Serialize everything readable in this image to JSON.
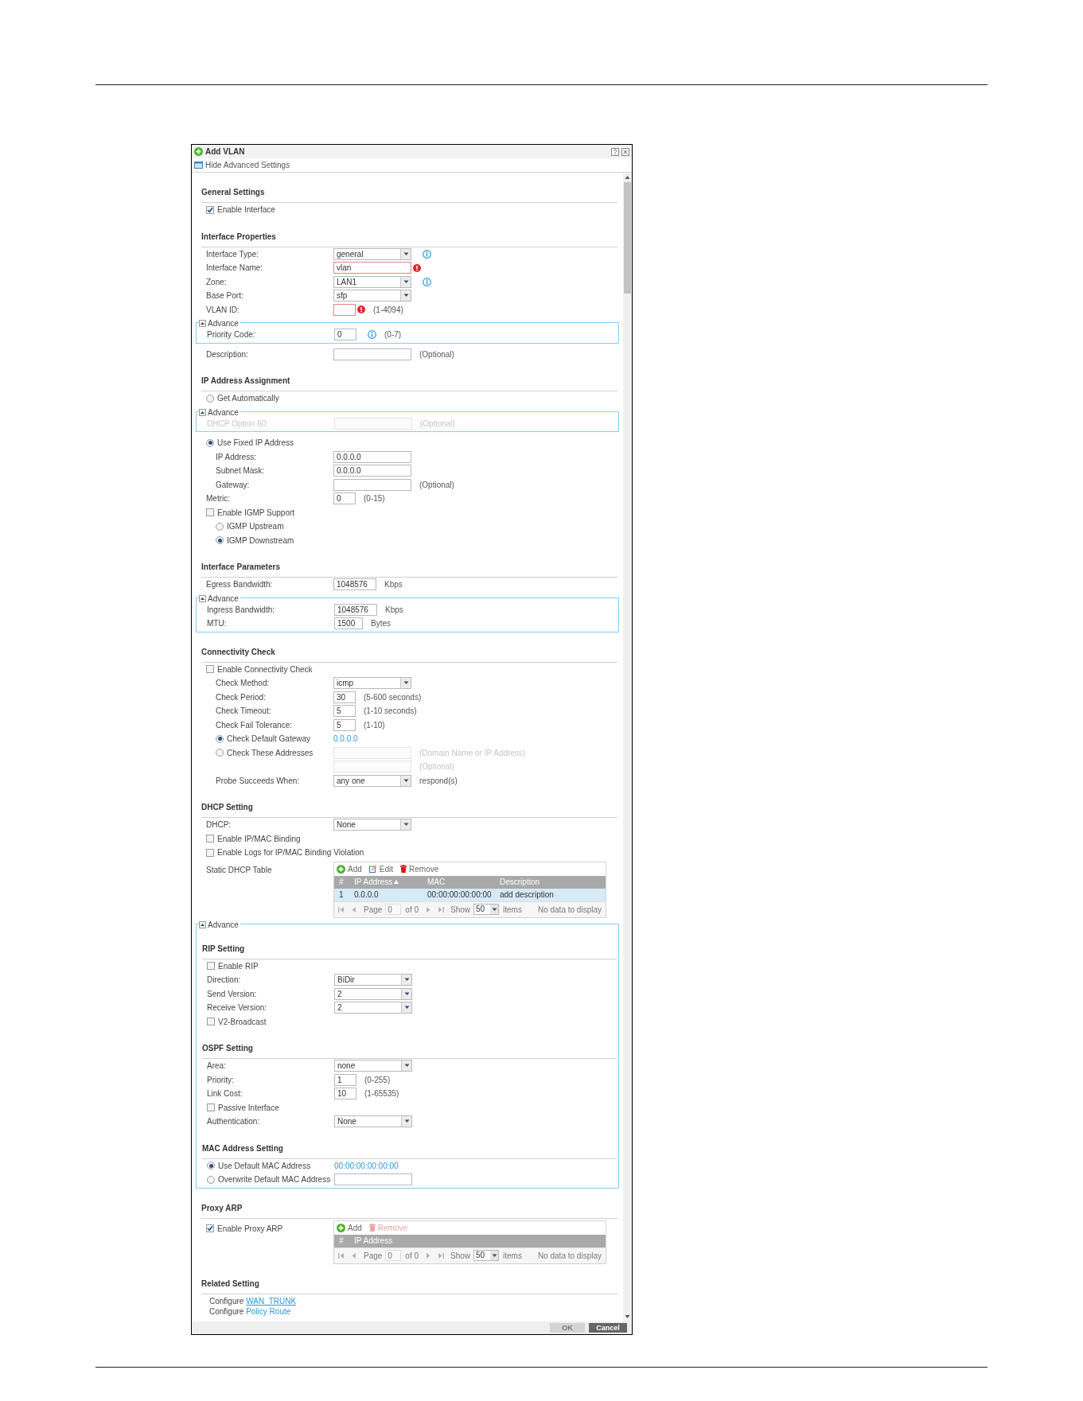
{
  "dialog": {
    "title": "Add VLAN",
    "toggle": "Hide Advanced Settings"
  },
  "body": [
    {
      "kind": "heading",
      "title": "General Settings"
    },
    {
      "kind": "checkbox",
      "label": "Enable Interface",
      "checked": true
    },
    {
      "kind": "heading",
      "title": "Interface Properties"
    },
    {
      "kind": "field",
      "label": "Interface Type:",
      "control": {
        "kind": "select",
        "value": "general"
      },
      "info": true
    },
    {
      "kind": "field",
      "label": "Interface Name:",
      "control": {
        "kind": "input",
        "value": "vlan"
      },
      "error": true
    },
    {
      "kind": "field",
      "label": "Zone:",
      "control": {
        "kind": "select",
        "value": "LAN1"
      },
      "info": true
    },
    {
      "kind": "field",
      "label": "Base Port:",
      "control": {
        "kind": "select",
        "value": "sfp"
      }
    },
    {
      "kind": "field",
      "label": "VLAN ID:",
      "control": {
        "kind": "number"
      },
      "error": true,
      "note": "(1-4094)"
    },
    {
      "kind": "advance",
      "label": "Advance",
      "expanded": true,
      "items": [
        {
          "kind": "field",
          "label": "Priority Code:",
          "control": {
            "kind": "number",
            "value": "0"
          },
          "note": "(0-7)",
          "info": true
        }
      ]
    },
    {
      "kind": "field",
      "label": "Description:",
      "control": {
        "kind": "input"
      },
      "note": "(Optional)"
    },
    {
      "kind": "heading",
      "title": "IP Address Assignment"
    },
    {
      "kind": "radio",
      "label": "Get Automatically",
      "selected": false
    },
    {
      "kind": "advance",
      "label": "Advance",
      "expanded": true,
      "items": [
        {
          "kind": "field",
          "label": "DHCP Option 60:",
          "control": {
            "kind": "input"
          },
          "note": "(Optional)",
          "disabled": true
        }
      ]
    },
    {
      "kind": "radio",
      "label": "Use Fixed IP Address",
      "selected": true,
      "children": [
        {
          "kind": "field",
          "label": "IP Address:",
          "control": {
            "kind": "input",
            "value": "0.0.0.0"
          }
        },
        {
          "kind": "field",
          "label": "Subnet Mask:",
          "control": {
            "kind": "input",
            "value": "0.0.0.0"
          }
        },
        {
          "kind": "field",
          "label": "Gateway:",
          "control": {
            "kind": "input"
          },
          "note": "(Optional)"
        }
      ]
    },
    {
      "kind": "field",
      "label": "Metric:",
      "control": {
        "kind": "number",
        "value": "0"
      },
      "note": "(0-15)"
    },
    {
      "kind": "checkbox",
      "label": "Enable IGMP Support",
      "checked": false,
      "children": [
        {
          "kind": "radio",
          "label": "IGMP Upstream",
          "selected": false
        },
        {
          "kind": "radio",
          "label": "IGMP Downstream",
          "selected": true
        }
      ]
    },
    {
      "kind": "heading",
      "title": "Interface Parameters"
    },
    {
      "kind": "field",
      "label": "Egress Bandwidth:",
      "control": {
        "kind": "number",
        "value": "1048576"
      },
      "note": "Kbps"
    },
    {
      "kind": "advance",
      "label": "Advance",
      "expanded": true,
      "items": [
        {
          "kind": "field",
          "label": "Ingress Bandwidth:",
          "control": {
            "kind": "number",
            "value": "1048576"
          },
          "note": "Kbps"
        },
        {
          "kind": "field",
          "label": "MTU:",
          "control": {
            "kind": "number",
            "value": "1500"
          },
          "note": "Bytes"
        }
      ]
    },
    {
      "kind": "heading",
      "title": "Connectivity Check"
    },
    {
      "kind": "checkbox",
      "label": "Enable Connectivity Check",
      "checked": false,
      "children": [
        {
          "kind": "field",
          "label": "Check Method:",
          "control": {
            "kind": "select",
            "value": "icmp"
          }
        },
        {
          "kind": "field",
          "label": "Check Period:",
          "control": {
            "kind": "number",
            "value": "30"
          },
          "note": "(5-600 seconds)"
        },
        {
          "kind": "field",
          "label": "Check Timeout:",
          "control": {
            "kind": "number",
            "value": "5"
          },
          "note": "(1-10 seconds)"
        },
        {
          "kind": "field",
          "label": "Check Fail Tolerance:",
          "control": {
            "kind": "number",
            "value": "5"
          },
          "note": "(1-10)"
        },
        {
          "kind": "radio",
          "label": "Check Default Gateway",
          "selected": true,
          "value": "0.0.0.0"
        },
        {
          "kind": "radio",
          "label": "Check These Addresses",
          "selected": false,
          "control": {
            "kind": "input"
          },
          "note": "(Domain Name or IP Address)",
          "disabled": true
        },
        {
          "kind": "field",
          "control": {
            "kind": "input"
          },
          "note": "(Optional)",
          "disabled": true
        },
        {
          "kind": "field",
          "label": "Probe Succeeds When:",
          "control": {
            "kind": "select",
            "value": "any one"
          },
          "note": "respond(s)"
        }
      ]
    },
    {
      "kind": "heading",
      "title": "DHCP Setting"
    },
    {
      "kind": "field",
      "label": "DHCP:",
      "control": {
        "kind": "select",
        "value": "None"
      }
    },
    {
      "kind": "checkbox",
      "label": "Enable IP/MAC Binding",
      "checked": false
    },
    {
      "kind": "checkbox",
      "label": "Enable Logs for IP/MAC Binding Violation",
      "checked": false
    },
    {
      "kind": "table",
      "caption": {
        "kind": "text",
        "label": "Static DHCP Table"
      },
      "toolbar": [
        {
          "kind": "add",
          "label": "Add",
          "disabled": false
        },
        {
          "kind": "edit",
          "label": "Edit",
          "disabled": false
        },
        {
          "kind": "remove",
          "label": "Remove",
          "disabled": false
        }
      ],
      "columns": [
        {
          "label": "#",
          "sorted": false
        },
        {
          "label": "IP Address",
          "sorted": true
        },
        {
          "label": "MAC",
          "sorted": false
        },
        {
          "label": "Description",
          "sorted": false
        }
      ],
      "rows": [
        {
          "cells": [
            "1",
            "0.0.0.0",
            "00:00:00:00:00:00",
            "add description"
          ],
          "selected": true
        }
      ],
      "pager": {
        "page_label": "Page",
        "page": "0",
        "of": "of 0",
        "show": "Show",
        "per_page": "50",
        "items": "items",
        "status": "No data to display"
      }
    },
    {
      "kind": "advance",
      "label": "Advance",
      "expanded": true,
      "items": [
        {
          "kind": "heading",
          "title": "RIP Setting"
        },
        {
          "kind": "checkbox",
          "label": "Enable RIP",
          "checked": false
        },
        {
          "kind": "field",
          "label": "Direction:",
          "control": {
            "kind": "select",
            "value": "BiDir"
          }
        },
        {
          "kind": "field",
          "label": "Send Version:",
          "control": {
            "kind": "select",
            "value": "2"
          }
        },
        {
          "kind": "field",
          "label": "Receive Version:",
          "control": {
            "kind": "select",
            "value": "2"
          }
        },
        {
          "kind": "checkbox",
          "label": "V2-Broadcast",
          "checked": false
        },
        {
          "kind": "heading",
          "title": "OSPF Setting"
        },
        {
          "kind": "field",
          "label": "Area:",
          "control": {
            "kind": "select",
            "value": "none"
          }
        },
        {
          "kind": "field",
          "label": "Priority:",
          "control": {
            "kind": "number",
            "value": "1"
          },
          "note": "(0-255)"
        },
        {
          "kind": "field",
          "label": "Link Cost:",
          "control": {
            "kind": "number",
            "value": "10"
          },
          "note": "(1-65535)"
        },
        {
          "kind": "checkbox",
          "label": "Passive Interface",
          "checked": false
        },
        {
          "kind": "field",
          "label": "Authentication:",
          "control": {
            "kind": "select",
            "value": "None"
          }
        },
        {
          "kind": "heading",
          "title": "MAC Address Setting"
        },
        {
          "kind": "radio",
          "label": "Use Default MAC Address",
          "selected": true,
          "value": "00:00:00:00:00:00"
        },
        {
          "kind": "radio",
          "label": "Overwrite Default MAC Address",
          "selected": false,
          "control": {
            "kind": "input"
          }
        }
      ]
    },
    {
      "kind": "heading",
      "title": "Proxy ARP"
    },
    {
      "kind": "table",
      "caption": {
        "kind": "checkbox",
        "label": "Enable Proxy ARP",
        "checked": true
      },
      "toolbar": [
        {
          "kind": "add",
          "label": "Add",
          "disabled": false
        },
        {
          "kind": "remove",
          "label": "Remove",
          "disabled": true
        }
      ],
      "columns": [
        {
          "label": "#",
          "sorted": false
        },
        {
          "label": "IP Address",
          "sorted": false
        }
      ],
      "pager": {
        "page_label": "Page",
        "page": "0",
        "of": "of 0",
        "show": "Show",
        "per_page": "50",
        "items": "items",
        "status": "No data to display"
      }
    },
    {
      "kind": "heading",
      "title": "Related Setting"
    },
    {
      "kind": "links",
      "lines": [
        {
          "text": "Configure",
          "link": "WAN_TRUNK",
          "underline": true
        },
        {
          "text": "Configure",
          "link": "Policy Route",
          "underline": false
        }
      ]
    }
  ],
  "buttons": [
    {
      "label": "OK",
      "kind": "ok",
      "disabled": true
    },
    {
      "label": "Cancel",
      "kind": "cancel",
      "disabled": false
    }
  ]
}
